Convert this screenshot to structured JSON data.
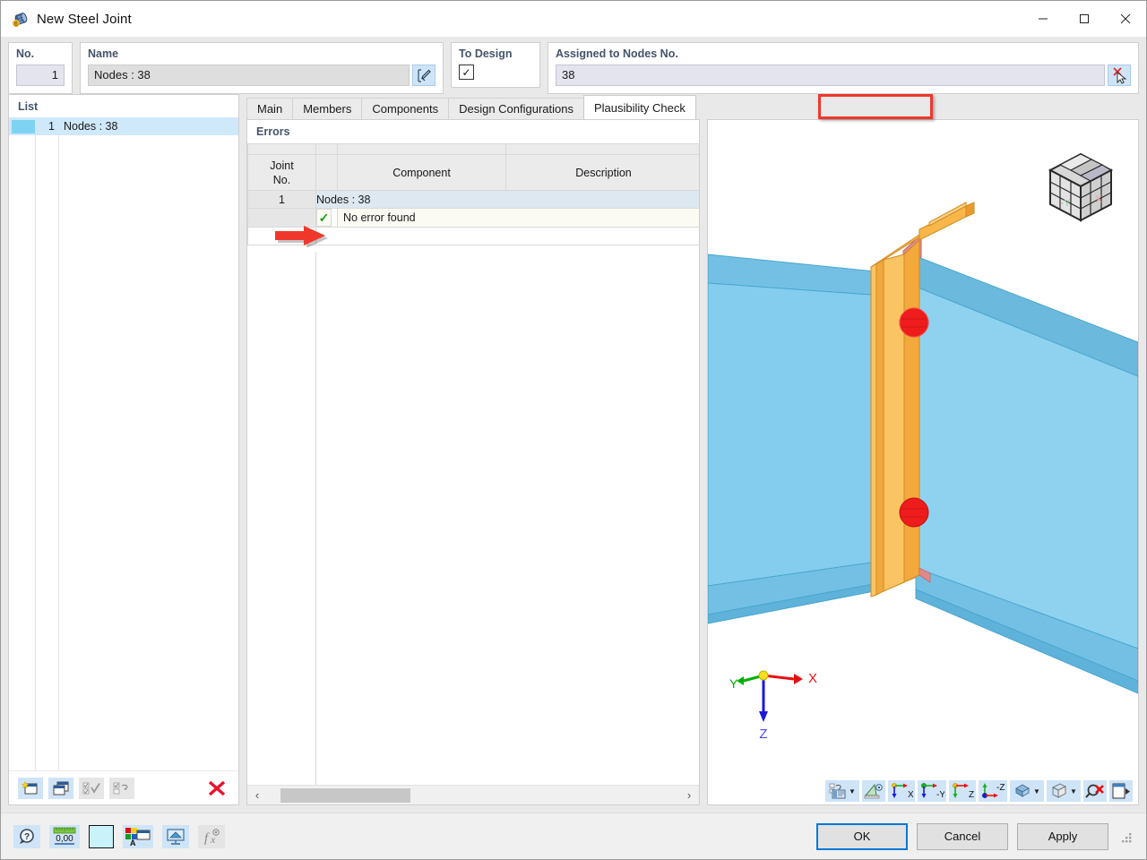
{
  "window": {
    "title": "New Steel Joint",
    "icon": "steel-joint-icon",
    "controls": {
      "minimize": "—",
      "maximize": "▢",
      "close": "✕"
    }
  },
  "list_panel": {
    "label": "List",
    "rows": [
      {
        "no": "1",
        "name": "Nodes : 38",
        "selected": true
      }
    ],
    "toolbar": [
      {
        "name": "new-joint-button",
        "enabled": true
      },
      {
        "name": "copy-joint-button",
        "enabled": true
      },
      {
        "name": "select-all-button",
        "enabled": false
      },
      {
        "name": "invert-selection-button",
        "enabled": false
      },
      {
        "name": "delete-joint-button",
        "enabled": true,
        "glyph": "✕"
      }
    ]
  },
  "header": {
    "no_label": "No.",
    "no_value": "1",
    "name_label": "Name",
    "name_value": "Nodes : 38",
    "name_edit_icon": "edit-pencil-icon",
    "to_design_label": "To Design",
    "to_design_checked": true,
    "to_design_glyph": "✓",
    "assigned_label": "Assigned to Nodes No.",
    "assigned_value": "38",
    "assigned_pick_icon": "pick-cursor-icon"
  },
  "tabs": {
    "items": [
      {
        "label": "Main",
        "active": false
      },
      {
        "label": "Members",
        "active": false
      },
      {
        "label": "Components",
        "active": false
      },
      {
        "label": "Design Configurations",
        "active": false
      },
      {
        "label": "Plausibility Check",
        "active": true
      }
    ],
    "highlight_color": "#f0372c"
  },
  "errors_panel": {
    "title": "Errors",
    "columns": [
      "Joint\nNo.",
      "",
      "Component",
      "Description"
    ],
    "col_joint_no_line1": "Joint",
    "col_joint_no_line2": "No.",
    "col_status": "",
    "col_component": "Component",
    "col_description": "Description",
    "rows": [
      {
        "type": "group",
        "joint_no": "1",
        "component": "Nodes : 38",
        "description": ""
      },
      {
        "type": "result",
        "joint_no": "",
        "status_icon": "check-icon",
        "status_glyph": "✓",
        "component": "No error found",
        "description": ""
      }
    ],
    "scrollbar": {
      "left_arrow": "‹",
      "right_arrow": "›"
    }
  },
  "viewport": {
    "nav_cube": {
      "name": "view-cube",
      "face_left": "-Y",
      "face_right": "X"
    },
    "axes": {
      "x": "X",
      "y": "Y",
      "z": "Z",
      "x_color": "#e81010",
      "y_color": "#00b000",
      "z_color": "#1010e0"
    },
    "model": {
      "beam_color": "#7ec8ea",
      "beam_shade_color": "#63b3d8",
      "plate_color": "#f5a93c",
      "plate_light_color": "#fbc05e",
      "bolt_color": "#ee1c1c",
      "weld_color": "#e07a7a"
    },
    "toolbar": [
      {
        "name": "display-properties-button",
        "has_caret": true
      },
      {
        "name": "measure-button",
        "has_caret": false
      },
      {
        "name": "view-in-x-button",
        "label": "X",
        "has_caret": false
      },
      {
        "name": "view-in-negative-y-button",
        "label": "-Y",
        "has_caret": false
      },
      {
        "name": "view-in-z-button",
        "label": "Z",
        "has_caret": false
      },
      {
        "name": "view-in-negative-z-button",
        "label": "-Z",
        "has_caret": false
      },
      {
        "name": "rendering-mode-button",
        "has_caret": true
      },
      {
        "name": "projection-mode-button",
        "has_caret": true
      },
      {
        "name": "zoom-reset-button",
        "has_caret": false
      },
      {
        "name": "print-view-button",
        "has_caret": false
      }
    ]
  },
  "bottom_bar": {
    "tools": [
      {
        "name": "help-button",
        "enabled": true
      },
      {
        "name": "units-button",
        "enabled": true,
        "label": "0,00"
      },
      {
        "name": "color-swatch-button",
        "enabled": true
      },
      {
        "name": "display-settings-button",
        "enabled": true
      },
      {
        "name": "visibility-button",
        "enabled": true
      },
      {
        "name": "formula-button",
        "enabled": false,
        "label": "f"
      }
    ],
    "buttons": [
      {
        "name": "ok-button",
        "label": "OK",
        "primary": true
      },
      {
        "name": "cancel-button",
        "label": "Cancel",
        "primary": false
      },
      {
        "name": "apply-button",
        "label": "Apply",
        "primary": false
      }
    ]
  },
  "annotations": {
    "arrow_color": "#f0372c",
    "tab_highlight": "Plausibility Check"
  }
}
